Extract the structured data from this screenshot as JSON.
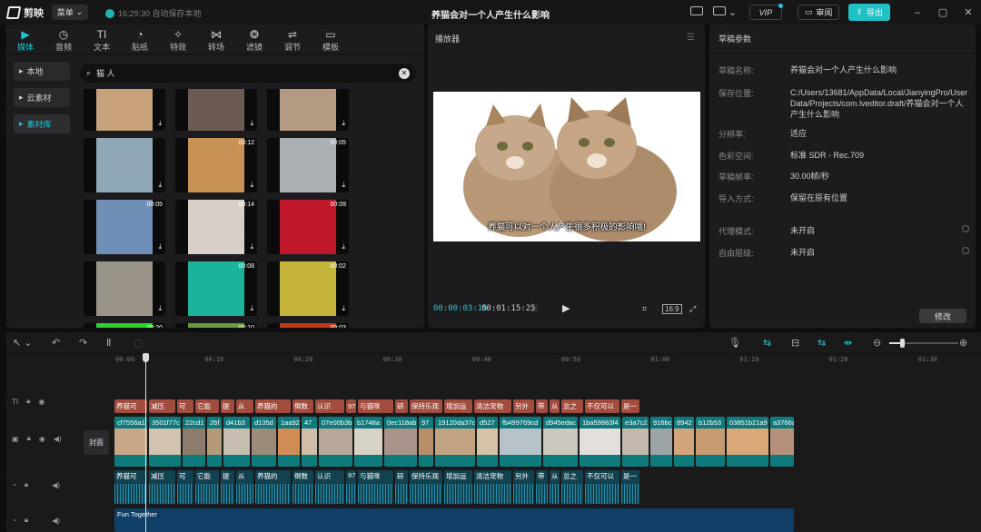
{
  "app": {
    "name": "剪映",
    "menu_label": "菜单",
    "save_status": "16:29:30 自动保存本地",
    "window_title": "养猫会对一个人产生什么影响",
    "vip_label": "VIP",
    "review_label": "审阅",
    "export_label": "导出"
  },
  "colors": {
    "accent": "#1fc7d4",
    "text_clip": "#a14c3c",
    "video_clip": "#0f7a7c",
    "audio_clip": "#12424f",
    "music_clip": "#0f3e66"
  },
  "media": {
    "tabs": [
      {
        "label": "媒体",
        "icon": "media-icon"
      },
      {
        "label": "音频",
        "icon": "audio-icon"
      },
      {
        "label": "文本",
        "icon": "text-icon"
      },
      {
        "label": "贴纸",
        "icon": "sticker-icon"
      },
      {
        "label": "特效",
        "icon": "effects-icon"
      },
      {
        "label": "转场",
        "icon": "transition-icon"
      },
      {
        "label": "滤镜",
        "icon": "filter-icon"
      },
      {
        "label": "调节",
        "icon": "adjust-icon"
      },
      {
        "label": "模板",
        "icon": "template-icon"
      }
    ],
    "side": [
      "本地",
      "云素材",
      "素材库"
    ],
    "search_value": "猫 人",
    "thumbs": [
      {
        "dur": "",
        "color": "#c7a27a"
      },
      {
        "dur": "",
        "color": "#6b5b52"
      },
      {
        "dur": "",
        "color": "#b59a83"
      },
      {
        "dur": "",
        "color": "#8fa8b8"
      },
      {
        "dur": "00:12",
        "color": "#c99255"
      },
      {
        "dur": "00:05",
        "color": "#aab0b3"
      },
      {
        "dur": "00:05",
        "color": "#6f8fb7"
      },
      {
        "dur": "00:14",
        "color": "#d8cfc8"
      },
      {
        "dur": "00:09",
        "color": "#c0182a"
      },
      {
        "dur": "",
        "color": "#9a948b"
      },
      {
        "dur": "00:08",
        "color": "#1bb39b"
      },
      {
        "dur": "00:02",
        "color": "#c4b43a"
      },
      {
        "dur": "00:20",
        "color": "#2ed22e"
      },
      {
        "dur": "00:10",
        "color": "#6b9a3a"
      },
      {
        "dur": "00:03",
        "color": "#c23a17"
      }
    ]
  },
  "player": {
    "title": "播放器",
    "subtitle": "养猫可以对一个人产生很多积极的影响哦!",
    "current_time": "00:00:03:15",
    "total_time": "00:01:15:25",
    "ratio": "16:9"
  },
  "draft": {
    "title": "草稿参数",
    "rows": [
      {
        "k": "草稿名称:",
        "v": "养猫会对一个人产生什么影响"
      },
      {
        "k": "保存位置:",
        "v": "C:/Users/13681/AppData/Local/JianyingPro/User Data/Projects/com.lveditor.draft/养猫会对一个人产生什么影响"
      },
      {
        "k": "分辨率:",
        "v": "适应"
      },
      {
        "k": "色彩空间:",
        "v": "标准 SDR - Rec.709"
      },
      {
        "k": "草稿帧率:",
        "v": "30.00帧/秒"
      },
      {
        "k": "导入方式:",
        "v": "保留在原有位置"
      },
      {
        "k": "代理模式:",
        "v": "未开启"
      },
      {
        "k": "自由层级:",
        "v": "未开启"
      }
    ],
    "modify_label": "修改"
  },
  "timeline": {
    "ticks": [
      "00:00",
      "00:10",
      "00:20",
      "00:30",
      "00:40",
      "00:50",
      "01:00",
      "01:10",
      "01:20",
      "01:30"
    ],
    "cover_label": "封面",
    "text_clips": [
      "养猫可",
      "减压",
      "可",
      "它能",
      "提",
      "从",
      "养猫的",
      "倒数",
      "认识",
      "97",
      "与猫咪",
      "研",
      "保持乐观",
      "增加运",
      "清洁宠物",
      "另外",
      "带",
      "从",
      "总之",
      "不仅可以",
      "是一"
    ],
    "video_clips": [
      "cf7556a1",
      "3501f77c",
      "22cd1",
      "26f",
      "d41b3",
      "d135d",
      "1aa92",
      "47",
      "07e00b3b",
      "b1748a",
      "0ec118ab",
      "97",
      "19120da37c",
      "d527",
      "fb499769cd",
      "d945edac",
      "1ba59883f4",
      "e3a7c2",
      "916bc",
      "8942",
      "b12b53",
      "03851b21a9",
      "a3766a"
    ],
    "audio_clips": [
      "养猫可",
      "减压",
      "可",
      "它能",
      "提",
      "从",
      "养猫的",
      "倒数",
      "认识",
      "97",
      "与猫咪",
      "研",
      "保持乐观",
      "增加运",
      "清洁宠物",
      "另外",
      "带",
      "从",
      "总之",
      "不仅可以",
      "是一"
    ],
    "music_label": "Fun Together"
  }
}
